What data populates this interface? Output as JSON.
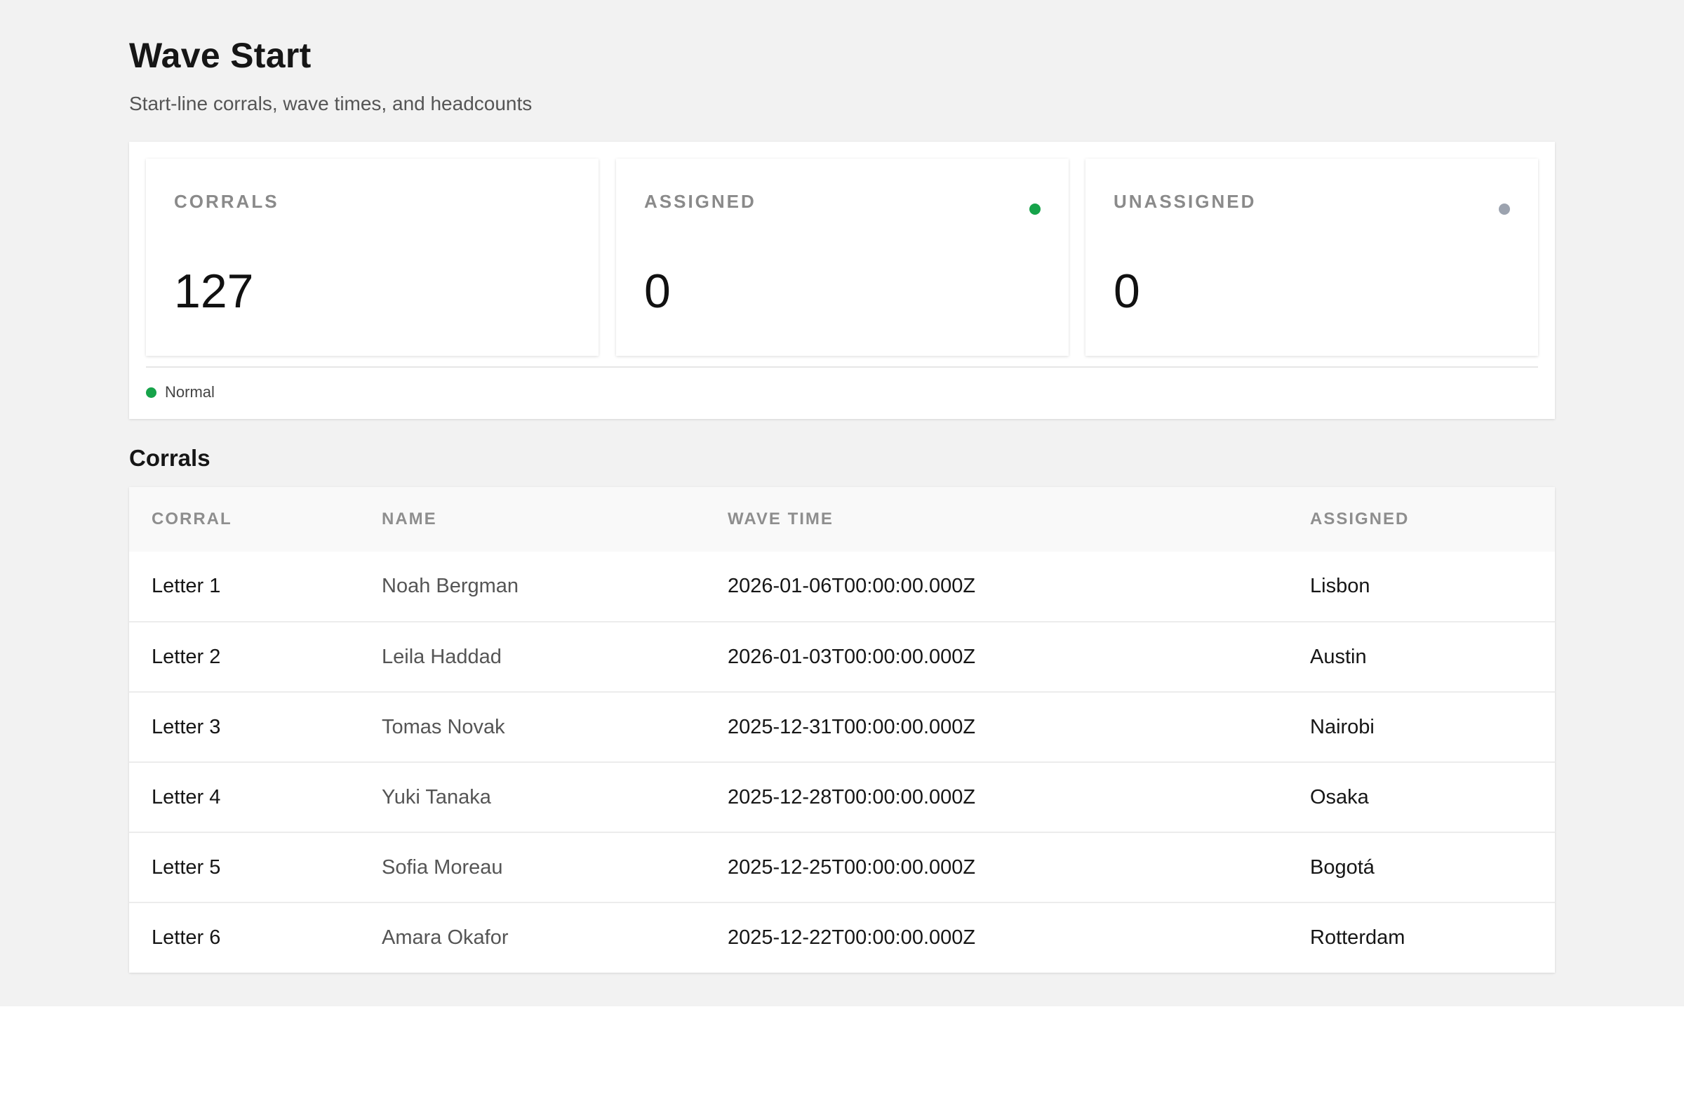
{
  "header": {
    "title": "Wave Start",
    "subtitle": "Start-line corrals, wave times, and headcounts"
  },
  "stats": [
    {
      "label": "CORRALS",
      "value": "127",
      "dot_color": null
    },
    {
      "label": "ASSIGNED",
      "value": "0",
      "dot_color": "#16a34a"
    },
    {
      "label": "UNASSIGNED",
      "value": "0",
      "dot_color": "#9ca3af"
    }
  ],
  "status": {
    "label": "Normal",
    "color": "#16a34a"
  },
  "table": {
    "title": "Corrals",
    "columns": [
      "CORRAL",
      "NAME",
      "WAVE TIME",
      "ASSIGNED"
    ],
    "rows": [
      [
        "Letter 1",
        "Noah Bergman",
        "2026-01-06T00:00:00.000Z",
        "Lisbon"
      ],
      [
        "Letter 2",
        "Leila Haddad",
        "2026-01-03T00:00:00.000Z",
        "Austin"
      ],
      [
        "Letter 3",
        "Tomas Novak",
        "2025-12-31T00:00:00.000Z",
        "Nairobi"
      ],
      [
        "Letter 4",
        "Yuki Tanaka",
        "2025-12-28T00:00:00.000Z",
        "Osaka"
      ],
      [
        "Letter 5",
        "Sofia Moreau",
        "2025-12-25T00:00:00.000Z",
        "Bogotá"
      ],
      [
        "Letter 6",
        "Amara Okafor",
        "2025-12-22T00:00:00.000Z",
        "Rotterdam"
      ]
    ]
  }
}
